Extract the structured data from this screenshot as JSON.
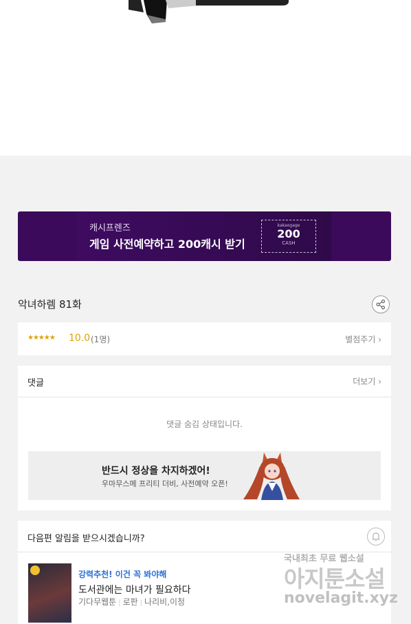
{
  "banner": {
    "subtitle": "캐시프렌즈",
    "title": "게임 사전예약하고 200캐시 받기",
    "coupon_top": "kakaogage",
    "coupon_amount": "200",
    "coupon_unit": "CASH"
  },
  "episode": {
    "title": "악녀하렘 81화",
    "share_icon": "share-icon"
  },
  "rating": {
    "stars": "★★★★★",
    "score": "10.0",
    "votes": "(1명)",
    "rate_link": "별점주기 ›"
  },
  "comments": {
    "header": "댓글",
    "more": "더보기 ›",
    "hidden_message": "댓글 숨김 상태입니다."
  },
  "ad": {
    "headline": "반드시 정상을 차지하겠어!",
    "subline": "우마무스메 프리티 더비, 사전예약 오픈!"
  },
  "notify": {
    "question": "다음편 알림을 받으시겠습니까?",
    "bell_icon": "bell-icon"
  },
  "recommendation": {
    "tag": "강력추천! 이건 꼭 봐야해",
    "title": "도서관에는 마녀가 필요하다",
    "genre": "기다무웹툰",
    "category": "로판",
    "authors": "나리비,이청"
  },
  "watermark": {
    "line1": "국내최초 무료 웹소설",
    "line2": "아지툰소설",
    "line3": "novelagit.xyz"
  },
  "colors": {
    "banner_bg": "#3b0a5a",
    "rating": "#e0a100",
    "link_blue": "#2a6fd6"
  }
}
